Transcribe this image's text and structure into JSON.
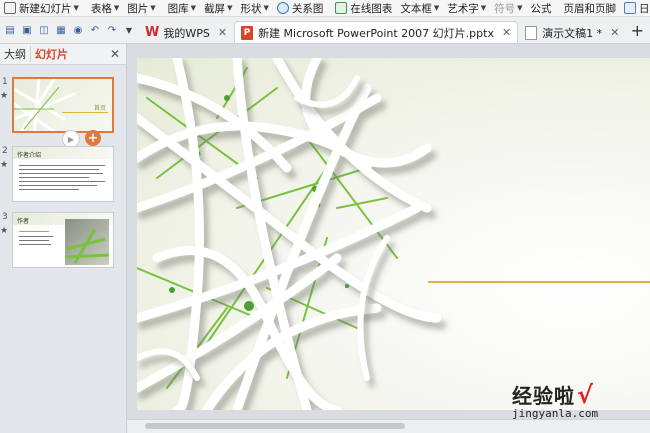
{
  "ribbon": {
    "items": [
      {
        "label": "新建幻灯片",
        "caret": true
      },
      {
        "label": "表格",
        "caret": true
      },
      {
        "label": "图片",
        "caret": true
      },
      {
        "label": "图库",
        "caret": true
      },
      {
        "label": "截屏",
        "caret": true
      },
      {
        "label": "形状",
        "caret": true
      },
      {
        "label": "关系图",
        "caret": false
      },
      {
        "label": "在线图表",
        "caret": false
      },
      {
        "label": "文本框",
        "caret": true
      },
      {
        "label": "艺术字",
        "caret": true
      },
      {
        "label": "符号",
        "caret": true
      },
      {
        "label": "公式",
        "caret": false
      },
      {
        "label": "页眉和页脚",
        "caret": false
      },
      {
        "label": "日期和时间",
        "caret": false
      }
    ]
  },
  "tabs": [
    {
      "label": "我的WPS",
      "icon": "wps-logo-icon"
    },
    {
      "label": "新建 Microsoft PowerPoint 2007 幻灯片.pptx",
      "icon": "ppt-file-icon",
      "active": true
    },
    {
      "label": "演示文稿1 *",
      "icon": "doc-file-icon"
    }
  ],
  "panel": {
    "tab_outline": "大纲",
    "tab_slides": "幻灯片",
    "slides": [
      {
        "number": "1",
        "title": "首页"
      },
      {
        "number": "2",
        "title": "作者介绍"
      },
      {
        "number": "3",
        "title": "作者"
      }
    ]
  },
  "watermark": {
    "text": "经验啦",
    "url": "jingyanla.com"
  },
  "colors": {
    "accent_orange": "#e07a3c",
    "ppt_red": "#d2492a",
    "slide_line": "#e2b23c",
    "stroke_green": "#6cc24a"
  }
}
